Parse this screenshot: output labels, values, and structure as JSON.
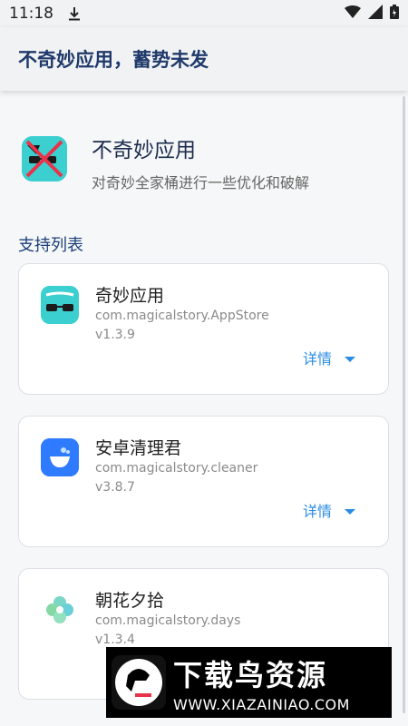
{
  "status_bar": {
    "time": "11:18",
    "icons": [
      "download-icon",
      "wifi-icon",
      "signal-icon",
      "battery-icon"
    ]
  },
  "app_bar": {
    "title": "不奇妙应用，蓄势未发"
  },
  "hero": {
    "name": "不奇妙应用",
    "description": "对奇妙全家桶进行一些优化和破解"
  },
  "section": {
    "title": "支持列表"
  },
  "apps": [
    {
      "name": "奇妙应用",
      "package": "com.magicalstory.AppStore",
      "version": "v1.3.9",
      "details_label": "详情",
      "icon": "magic-glasses-icon"
    },
    {
      "name": "安卓清理君",
      "package": "com.magicalstory.cleaner",
      "version": "v3.8.7",
      "details_label": "详情",
      "icon": "cleaner-icon"
    },
    {
      "name": "朝花夕拾",
      "package": "com.magicalstory.days",
      "version": "v1.3.4",
      "details_label": "",
      "icon": "flower-icon"
    }
  ],
  "watermark": {
    "title": "下载鸟资源",
    "url": "WWW.XIAZAINIAO.COM"
  },
  "colors": {
    "accent": "#2b8ce3",
    "title": "#1f3a6a",
    "section": "#1c3f79",
    "cleaner": "#2f7bff",
    "teal": "#3ccfcf"
  }
}
